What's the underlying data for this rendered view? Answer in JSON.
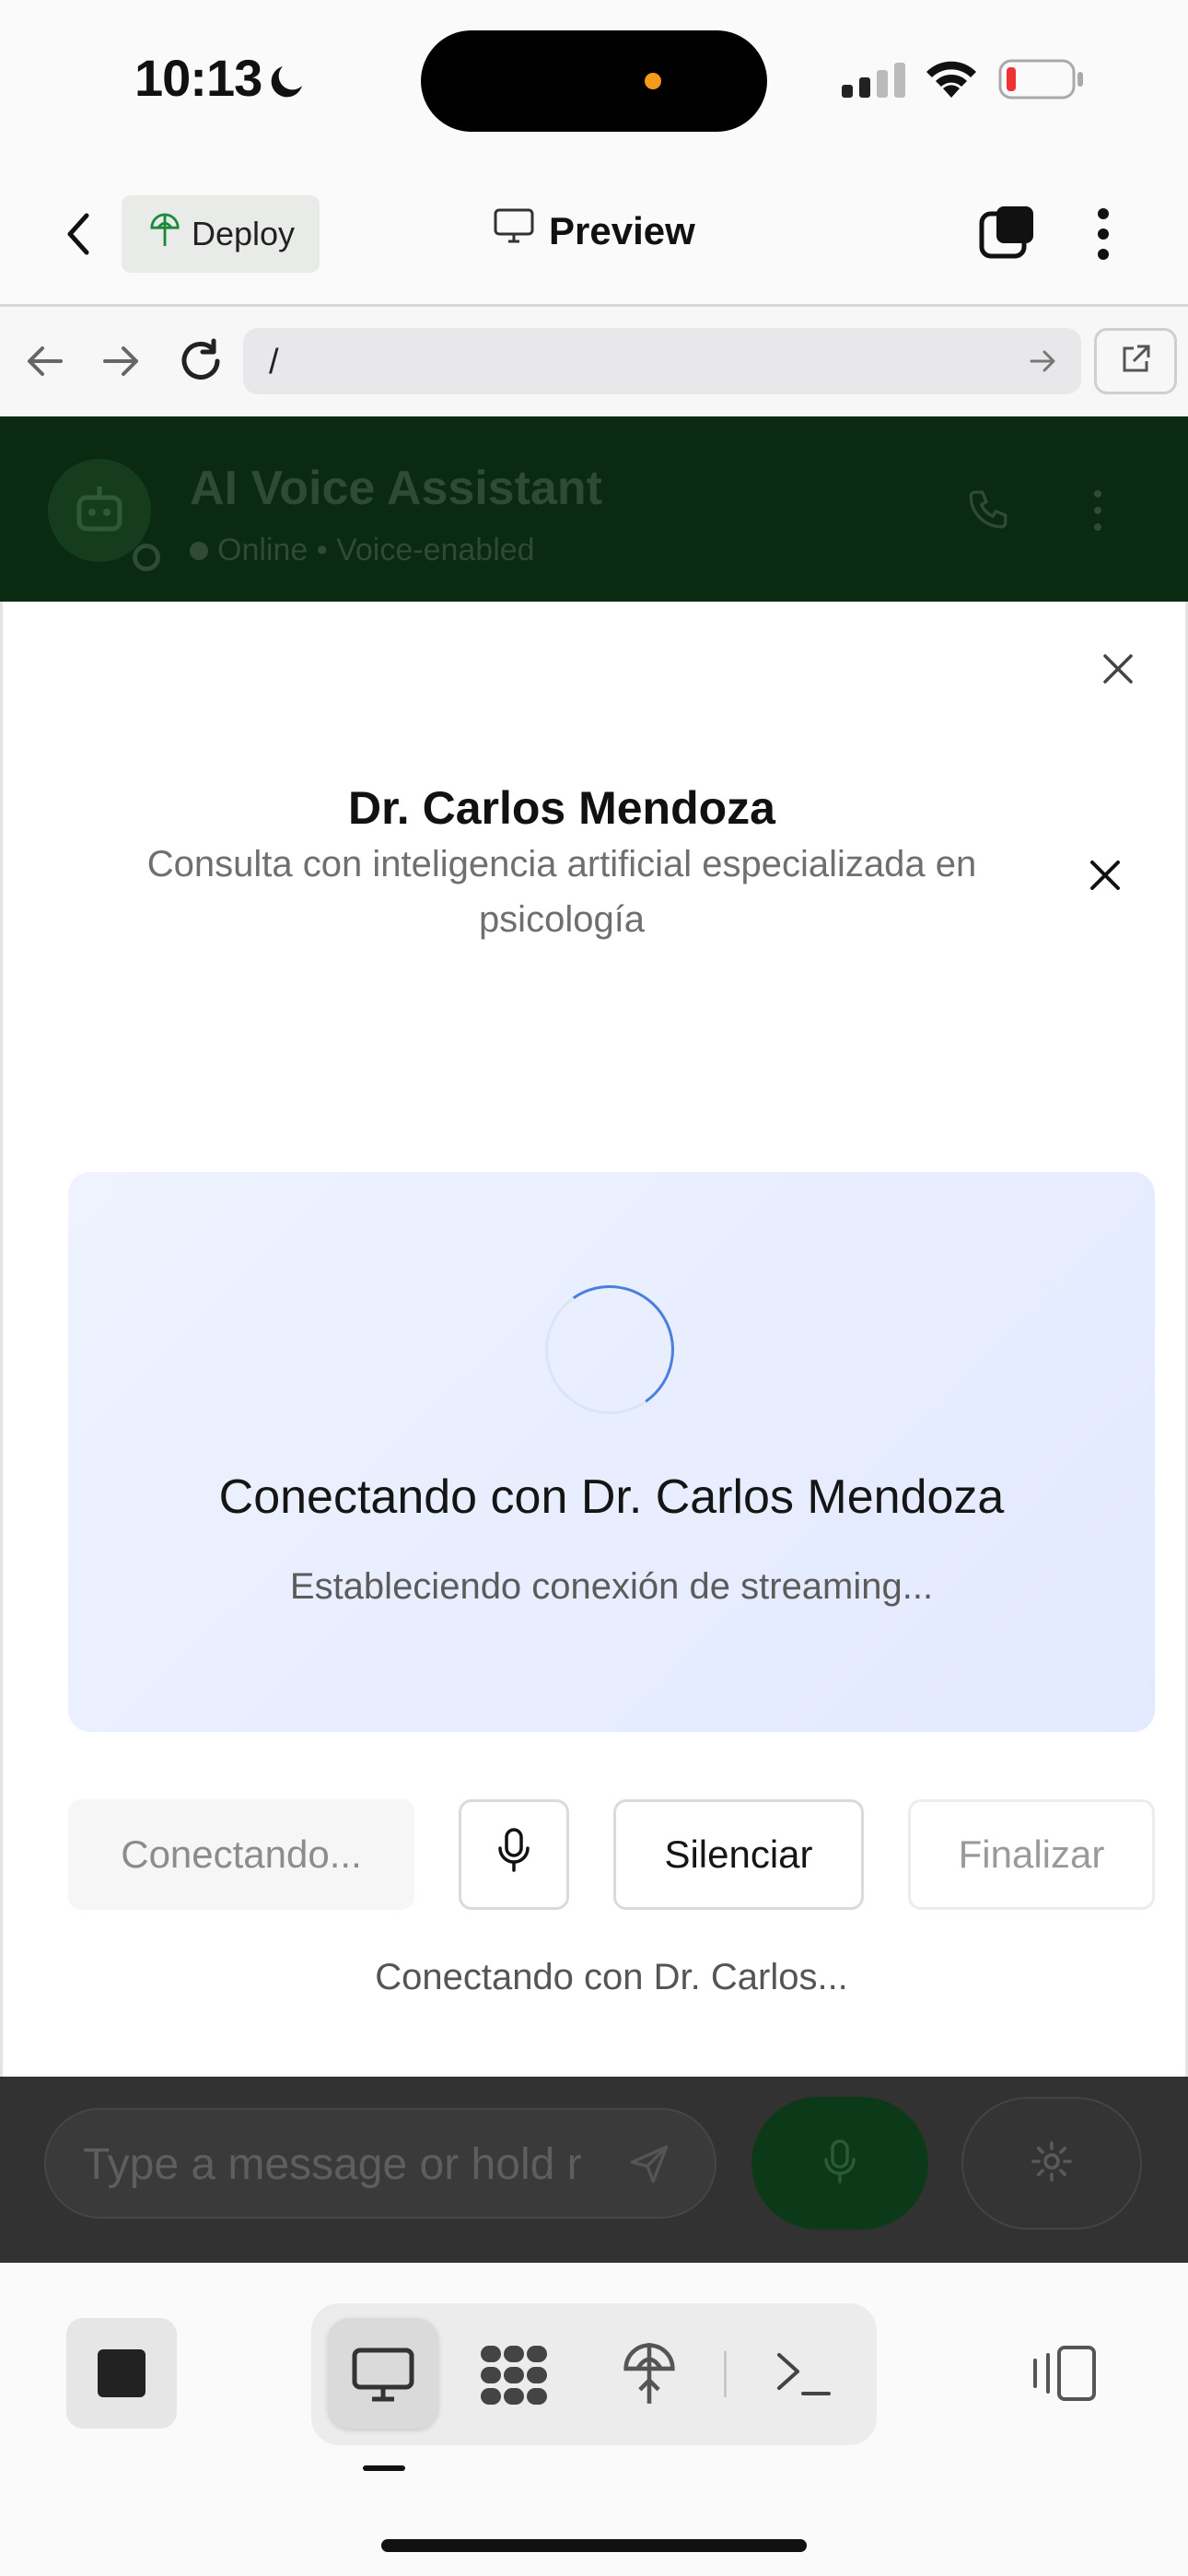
{
  "status_bar": {
    "time": "10:13",
    "icons": [
      "moon-icon",
      "signal-icon",
      "wifi-icon",
      "battery-low-icon"
    ]
  },
  "top_bar": {
    "back_icon": "chevron-left-icon",
    "deploy_label": "Deploy",
    "preview_label": "Preview",
    "tabs_icon": "tabs-icon",
    "more_icon": "more-vertical-icon"
  },
  "url_bar": {
    "url": "/",
    "nav_icons": [
      "arrow-left-icon",
      "arrow-right-icon",
      "reload-icon",
      "go-arrow-icon",
      "external-link-icon"
    ]
  },
  "background_app": {
    "title": "AI Voice Assistant",
    "status": "Online • Voice-enabled",
    "message_placeholder": "Type a message or hold r"
  },
  "modal": {
    "doctor_name": "Dr. Carlos Mendoza",
    "subtitle": "Consulta con inteligencia artificial especializada en psicología",
    "card_title": "Conectando con Dr. Carlos Mendoza",
    "card_subtitle": "Estableciendo conexión de streaming...",
    "controls": {
      "connecting": "Conectando...",
      "mute": "Silenciar",
      "end": "Finalizar"
    },
    "status_text": "Conectando con Dr. Carlos..."
  },
  "bottom_toolbar": {
    "icons": [
      "stop-icon",
      "desktop-icon",
      "apps-icon",
      "deploy-icon",
      "terminal-icon",
      "split-view-icon"
    ]
  },
  "colors": {
    "accent_blue": "#4a7fe0",
    "card_bg": "#e3e9ff",
    "dim_green": "#0a2a12"
  }
}
